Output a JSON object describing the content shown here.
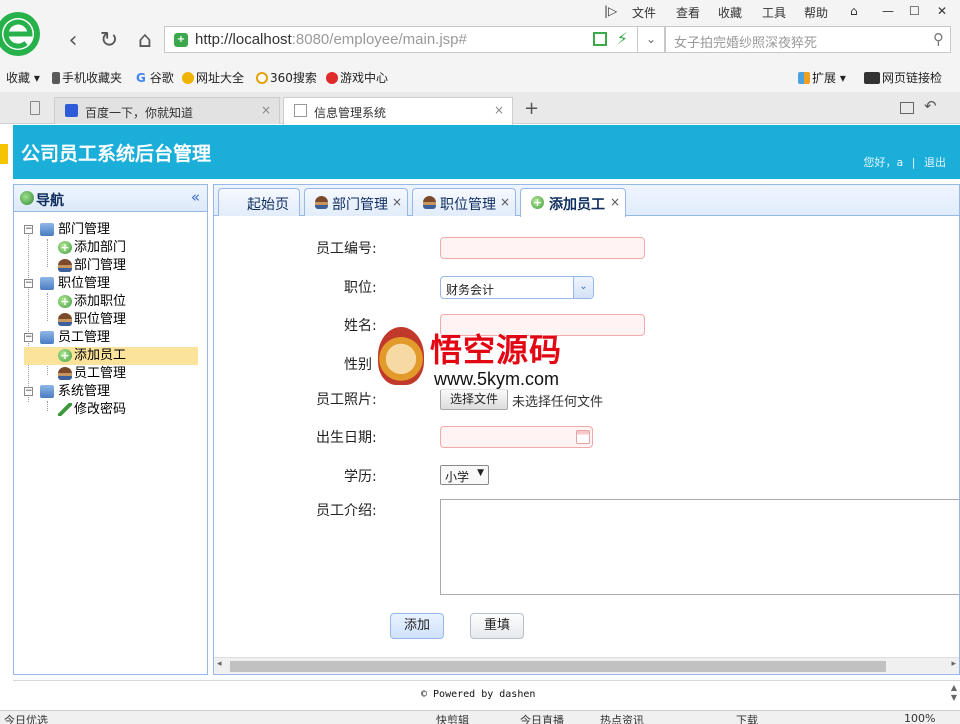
{
  "browser": {
    "menu": [
      "文件",
      "查看",
      "收藏",
      "工具",
      "帮助"
    ],
    "url_host": "http://localhost",
    "url_rest": ":8080/employee/main.jsp#",
    "search_placeholder": "女子拍完婚纱照深夜猝死",
    "bookmarks": [
      "收藏",
      "手机收藏夹",
      "谷歌",
      "网址大全",
      "360搜索",
      "游戏中心"
    ],
    "bookmarks_right": [
      "扩展",
      "网页链接检"
    ],
    "tabs": [
      {
        "title": "百度一下，你就知道"
      },
      {
        "title": "信息管理系统"
      }
    ],
    "new_tab": "+"
  },
  "app": {
    "title": "公司员工系统后台管理",
    "greeting": "您好，a",
    "separator": "|",
    "logout": "退出"
  },
  "nav": {
    "title": "导航",
    "collapse": "«",
    "groups": [
      {
        "label": "部门管理",
        "items": [
          "添加部门",
          "部门管理"
        ]
      },
      {
        "label": "职位管理",
        "items": [
          "添加职位",
          "职位管理"
        ]
      },
      {
        "label": "员工管理",
        "items": [
          "添加员工",
          "员工管理"
        ]
      },
      {
        "label": "系统管理",
        "items": [
          "修改密码"
        ]
      }
    ],
    "selected": "添加员工"
  },
  "content_tabs": [
    {
      "label": "起始页",
      "closable": false
    },
    {
      "label": "部门管理",
      "closable": true
    },
    {
      "label": "职位管理",
      "closable": true
    },
    {
      "label": "添加员工",
      "closable": true,
      "active": true
    }
  ],
  "form": {
    "emp_no_label": "员工编号:",
    "position_label": "职位:",
    "position_value": "财务会计",
    "name_label": "姓名:",
    "gender_label": "性别",
    "photo_label": "员工照片:",
    "file_button": "选择文件",
    "file_status": "未选择任何文件",
    "birth_label": "出生日期:",
    "education_label": "学历:",
    "education_value": "小学",
    "intro_label": "员工介绍:",
    "submit": "添加",
    "reset": "重填"
  },
  "footer": {
    "text": "© Powered by dashen"
  },
  "statusbar": {
    "left": "今日优选",
    "items": [
      "快剪辑",
      "今日直播",
      "热点资讯",
      "下载",
      "100%"
    ]
  },
  "watermark": {
    "title": "悟空源码",
    "url": "www.5kym.com"
  }
}
